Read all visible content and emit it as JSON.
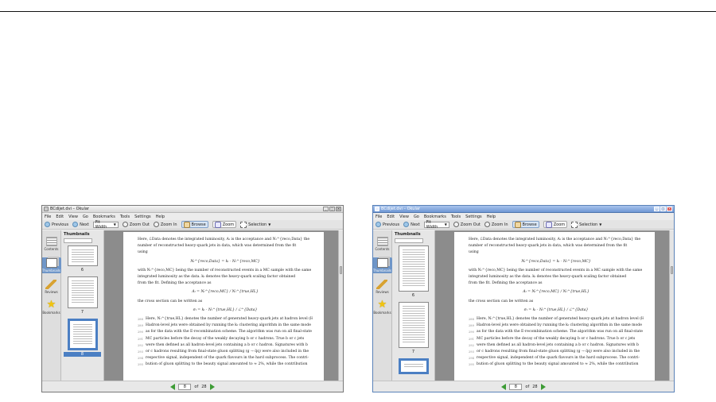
{
  "window": {
    "title": "BCdijet.dvi – Okular"
  },
  "window_buttons": {
    "minimize": "_",
    "maximize": "□",
    "close": "×"
  },
  "menu": [
    "File",
    "Edit",
    "View",
    "Go",
    "Bookmarks",
    "Tools",
    "Settings",
    "Help"
  ],
  "toolbar": {
    "previous": "Previous",
    "next": "Next",
    "zoom_value": "Fit Width",
    "zoom_out": "Zoom Out",
    "zoom_in": "Zoom In",
    "browse": "Browse",
    "zoom_tool": "Zoom",
    "selection": "Selection"
  },
  "sidebar": [
    {
      "label": "Contents",
      "icon": "contents-icon"
    },
    {
      "label": "Thumbnails",
      "icon": "thumbnails-icon"
    },
    {
      "label": "Reviews",
      "icon": "pencil-icon"
    },
    {
      "label": "Bookmarks",
      "icon": "star-icon"
    }
  ],
  "thumbnails": {
    "title": "Thumbnails",
    "left_pages": [
      "6",
      "7",
      "8"
    ],
    "right_pages": [
      "6",
      "7"
    ]
  },
  "document": {
    "lines_top": [
      "Here, ℒData denotes the integrated luminosity, Aₗ is the acceptance and Nₗ^{reco,Data} the",
      "number of reconstructed heavy-quark jets in data, which was determined from the fit",
      "using"
    ],
    "eq1": "Nₗ^{reco,Data} = kₗ · Nₗ^{reco,MC}",
    "lines_mid": [
      "with Nₗ^{reco,MC} being the number of reconstructed events in a MC sample with the same",
      "integrated luminosity as the data.  kₗ denotes the heavy-quark scaling factor obtained",
      "from the fit.  Defining the acceptance as"
    ],
    "eq2": "Aₗ = Nₗ^{reco,MC} / Nₗ^{true,HL}",
    "line_cs": "the cross section can be written as",
    "eq3": "σₗ = kₗ · Nₗ^{true,HL} / ℒ^{Data}",
    "numbered_lines": [
      {
        "n": "288",
        "t": "Here, Nₗ^{true,HL} denotes the number of generated heavy-quark jets at hadron level (HL)."
      },
      {
        "n": "289",
        "t": "Hadron-level jets were obtained by running the kₜ clustering algorithm in the same mode"
      },
      {
        "n": "290",
        "t": "as for the data with the E-recombination scheme. The algorithm was run on all final-state"
      },
      {
        "n": "291",
        "t": "MC particles before the decay of the weakly decaying b or c hadrons.  True b or c jets"
      },
      {
        "n": "292",
        "t": "were then defined as all hadron-level jets containing a b or c hadron.  Signatures with b"
      },
      {
        "n": "293",
        "t": "or c hadrons resulting from final-state gluon splitting (g → q̅q) were also included in the"
      },
      {
        "n": "294",
        "t": "respective signal, independent of the quark flavours in the hard subprocess.  The contri-"
      },
      {
        "n": "295",
        "t": "bution of gluon splitting to the beauty signal amounted to ≈ 2%, while the contribution"
      }
    ]
  },
  "status": {
    "page_current": "8",
    "of_label": "of",
    "page_total": "28"
  }
}
